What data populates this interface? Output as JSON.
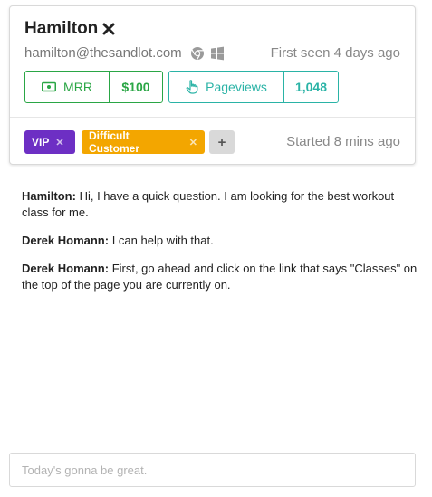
{
  "customer": {
    "name": "Hamilton",
    "email": "hamilton@thesandlot.com",
    "first_seen": "First seen 4 days ago"
  },
  "stats": {
    "mrr": {
      "label": "MRR",
      "value": "$100",
      "icon": "money-icon",
      "color": "#2aa645"
    },
    "pageviews": {
      "label": "Pageviews",
      "value": "1,048",
      "icon": "pointer-hand-icon",
      "color": "#2ab3a6"
    }
  },
  "tags": [
    {
      "label": "VIP",
      "color": "#6d2fc4"
    },
    {
      "label": "Difficult Customer",
      "color": "#f3a600"
    }
  ],
  "add_tag_label": "+",
  "started": "Started 8 mins ago",
  "messages": [
    {
      "author": "Hamilton:",
      "text": " Hi, I have a quick question. I am looking for the best workout class for me."
    },
    {
      "author": "Derek Homann:",
      "text": " I can help with that."
    },
    {
      "author": "Derek Homann:",
      "text": " First, go ahead and click on the link that says \"Classes\" on the top of the page you are currently on."
    }
  ],
  "composer": {
    "placeholder": "Today's gonna be great.",
    "value": ""
  }
}
